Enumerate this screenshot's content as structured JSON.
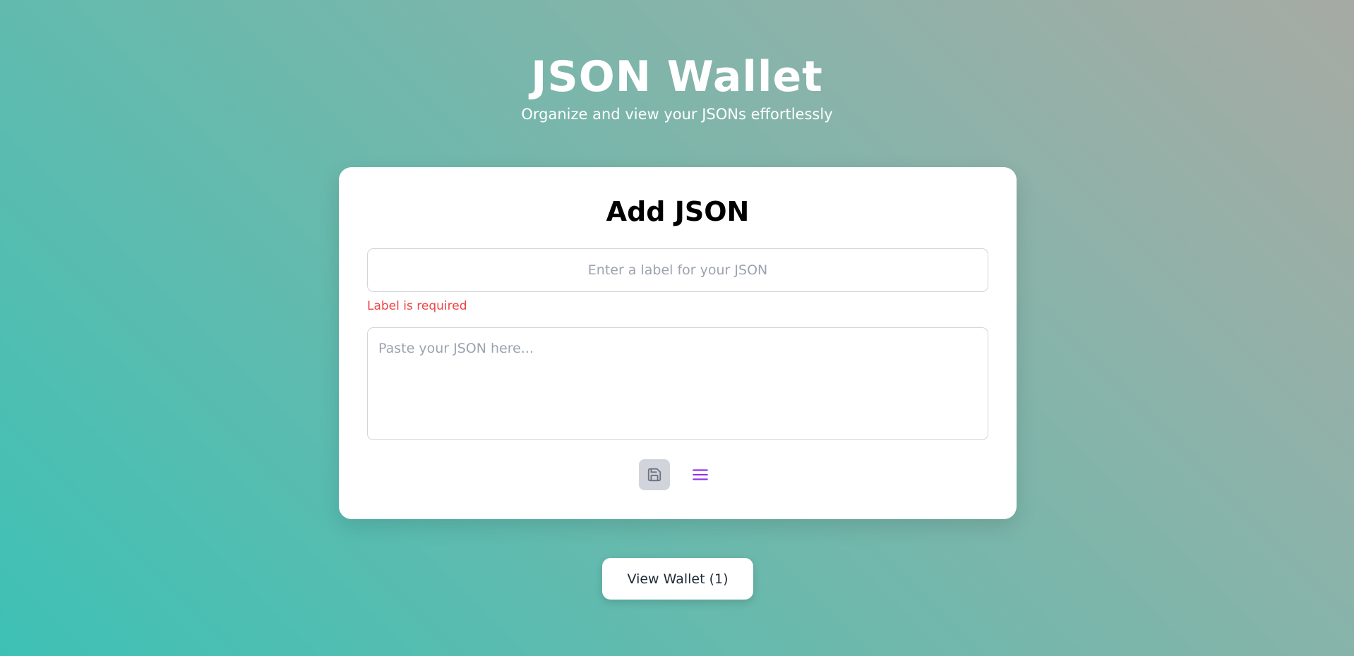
{
  "header": {
    "title": "JSON Wallet",
    "subtitle": "Organize and view your JSONs effortlessly"
  },
  "card": {
    "title": "Add JSON",
    "label_input": {
      "placeholder": "Enter a label for your JSON",
      "value": ""
    },
    "label_error": "Label is required",
    "json_textarea": {
      "placeholder": "Paste your JSON here...",
      "value": ""
    },
    "actions": {
      "save_icon": "save-icon",
      "format_icon": "menu-lines-icon"
    }
  },
  "view_wallet_button": {
    "label": "View Wallet (1)"
  },
  "colors": {
    "error": "#ef4444",
    "accent": "#9333ea",
    "save_button_bg": "#d1d5db",
    "save_icon": "#6b7280"
  }
}
